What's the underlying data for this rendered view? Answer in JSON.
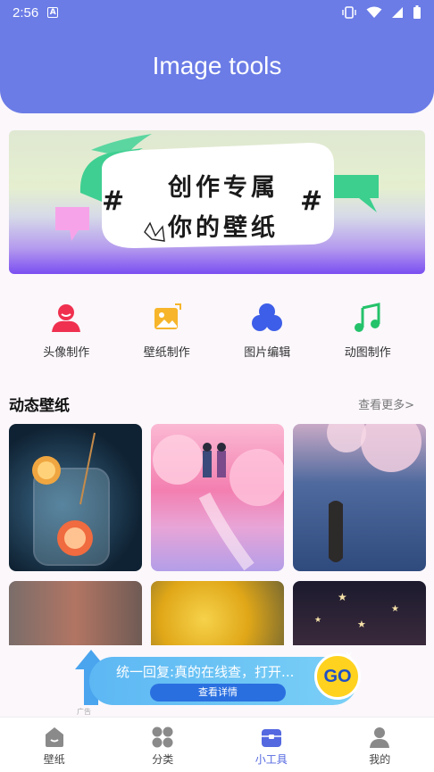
{
  "status_bar": {
    "time": "2:56",
    "notification_badge": "A"
  },
  "header": {
    "title": "Image tools",
    "color": "#6b7ce6"
  },
  "banner": {
    "line1": "创作专属",
    "line2": "你的壁纸",
    "hash": "#"
  },
  "tools": [
    {
      "label": "头像制作",
      "icon": "avatar-icon",
      "color": "#f0304f"
    },
    {
      "label": "壁纸制作",
      "icon": "wallpaper-icon",
      "color": "#f6b52a"
    },
    {
      "label": "图片编辑",
      "icon": "edit-icon",
      "color": "#3d5ee8"
    },
    {
      "label": "动图制作",
      "icon": "music-note-icon",
      "color": "#24c26a"
    }
  ],
  "section": {
    "title": "动态壁纸",
    "see_more": "查看更多>"
  },
  "ad": {
    "text": "统一回复:真的在线查，打开...",
    "button": "查看详情",
    "go": "GO",
    "close": "✕",
    "tag": "广告"
  },
  "nav": [
    {
      "label": "壁纸",
      "icon": "wallpaper-nav-icon",
      "active": false
    },
    {
      "label": "分类",
      "icon": "category-icon",
      "active": false
    },
    {
      "label": "小工具",
      "icon": "toolbox-icon",
      "active": true
    },
    {
      "label": "我的",
      "icon": "profile-icon",
      "active": false
    }
  ]
}
